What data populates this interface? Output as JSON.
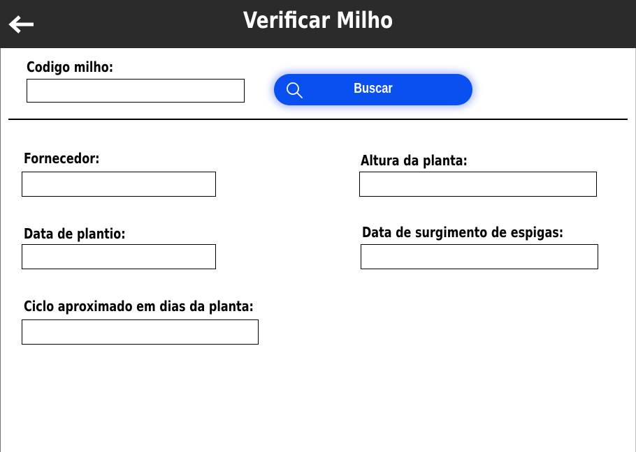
{
  "header": {
    "title": "Verificar Milho",
    "back_icon": "arrow-left-icon"
  },
  "search": {
    "code_label": "Codigo milho:",
    "code_value": "",
    "button_label": "Buscar",
    "button_icon": "search-icon",
    "button_color": "#0a4ff0"
  },
  "form": {
    "fornecedor_label": "Fornecedor:",
    "fornecedor_value": "",
    "altura_label": "Altura da planta:",
    "altura_value": "",
    "data_plantio_label": "Data de plantio:",
    "data_plantio_value": "",
    "data_espigas_label": "Data de surgimento de espigas:",
    "data_espigas_value": "",
    "ciclo_label": "Ciclo aproximado em dias da planta:",
    "ciclo_value": ""
  },
  "colors": {
    "header_bg": "#2b2b2b",
    "accent": "#0a4ff0"
  }
}
